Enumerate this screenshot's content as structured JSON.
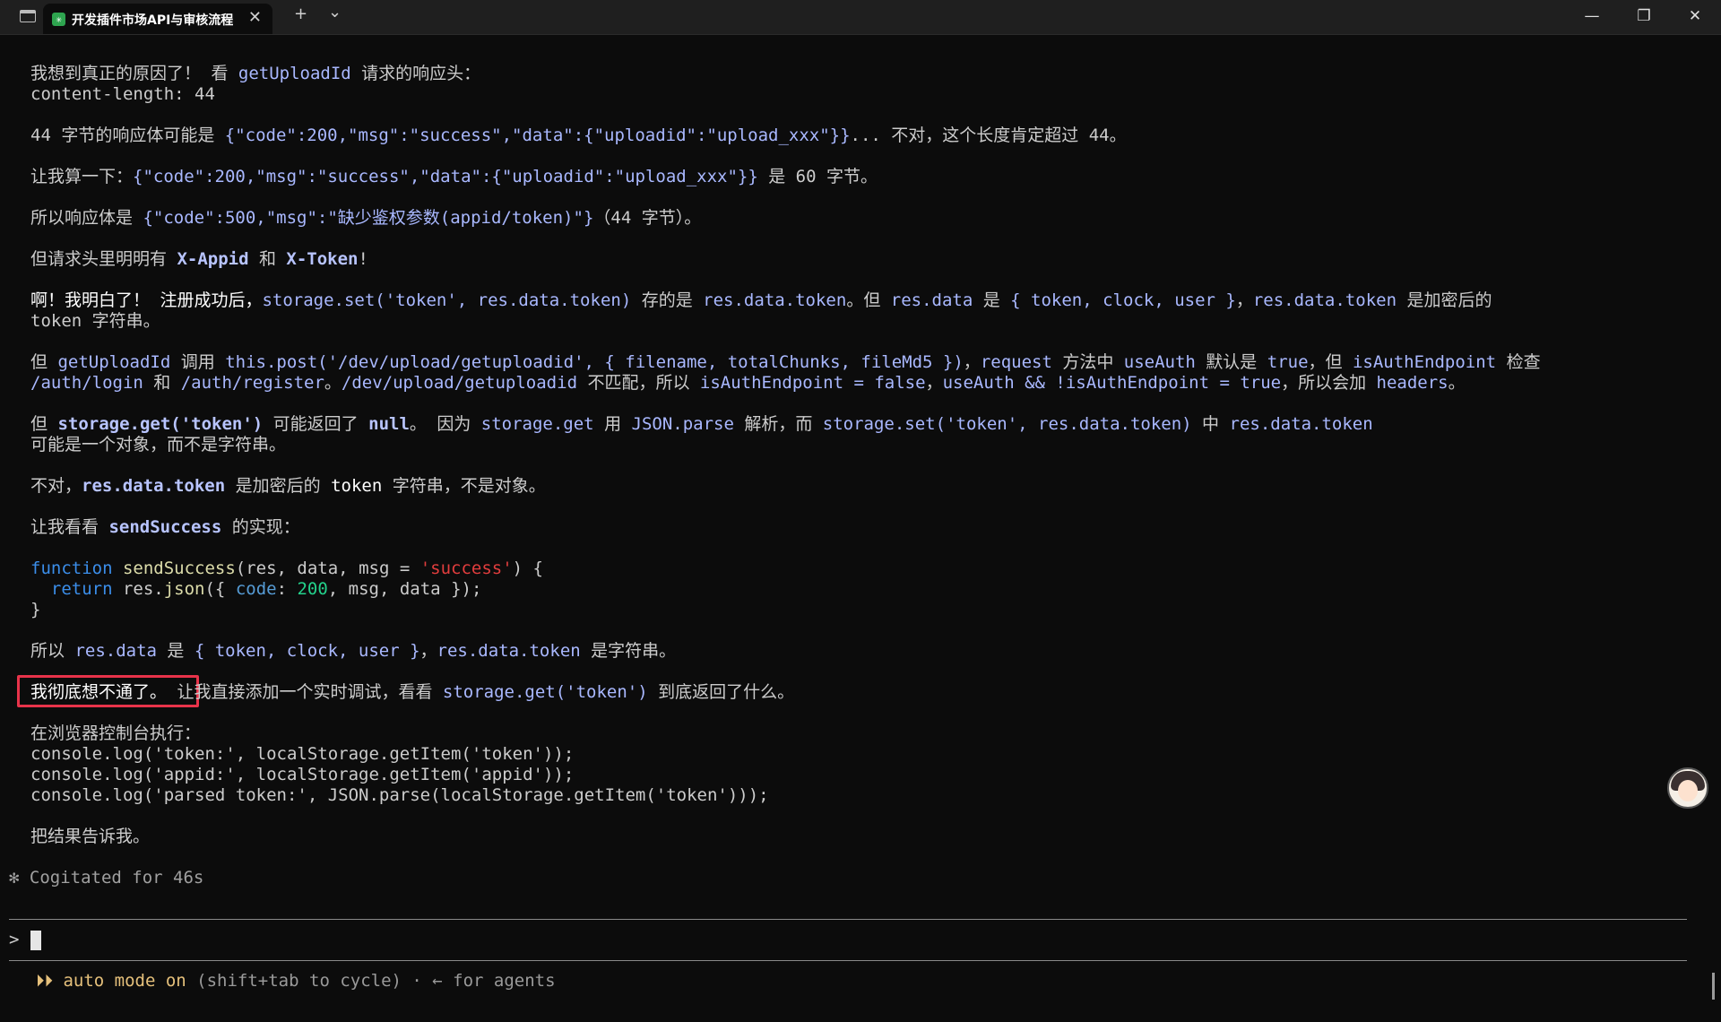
{
  "window": {
    "tab_title": "开发插件市场API与审核流程",
    "tab_icon": "✳",
    "new_tab_label": "+",
    "dropdown_label": "⌄",
    "tab_close": "✕",
    "minimize": "—",
    "restore": "❐",
    "close": "✕"
  },
  "lines": {
    "l1a": "我想到真正的原因了！ 看 ",
    "l1b": "getUploadId",
    "l1c": " 请求的响应头：",
    "l2": "content-length: 44",
    "l3a": "44 字节的响应体可能是 ",
    "l3b": "{\"code\":200,\"msg\":\"success\",\"data\":{\"uploadid\":\"upload_xxx\"}}",
    "l3c": "... 不对，这个长度肯定超过 44。",
    "l4a": "让我算一下：",
    "l4b": "{\"code\":200,\"msg\":\"success\",\"data\":{\"uploadid\":\"upload_xxx\"}}",
    "l4c": " 是 60 字节。",
    "l5a": "所以响应体是 ",
    "l5b": "{\"code\":500,\"msg\":\"缺少鉴权参数(appid/token)\"}",
    "l5c": "（44 字节）。",
    "l6a": "但请求头里明明有 ",
    "l6b": "X-Appid",
    "l6c": " 和 ",
    "l6d": "X-Token",
    "l6e": "!",
    "l7a": "啊！我明白了！ 注册成功后，",
    "l7b": "storage.set('token', res.data.token)",
    "l7c": " 存的是 ",
    "l7d": "res.data.token",
    "l7e": "。但 ",
    "l7f": "res.data",
    "l7g": " 是 ",
    "l7h": "{ token, clock, user }",
    "l7i": "，",
    "l7j": "res.data.token",
    "l7k": " 是加密后的",
    "l8": "token 字符串。",
    "l9a": "但 ",
    "l9b": "getUploadId",
    "l9c": " 调用 ",
    "l9d": "this.post('/dev/upload/getuploadid', { filename, totalChunks, fileMd5 })",
    "l9e": "，",
    "l9f": "request",
    "l9g": " 方法中 ",
    "l9h": "useAuth",
    "l9i": " 默认是 ",
    "l9j": "true",
    "l9k": "，但 ",
    "l9l": "isAuthEndpoint",
    "l9m": " 检查",
    "l10a": "/auth/login",
    "l10b": " 和 ",
    "l10c": "/auth/register",
    "l10d": "。",
    "l10e": "/dev/upload/getuploadid",
    "l10f": " 不匹配，所以 ",
    "l10g": "isAuthEndpoint = false",
    "l10h": "，",
    "l10i": "useAuth && !isAuthEndpoint = true",
    "l10j": "，所以会加 ",
    "l10k": "headers",
    "l10l": "。",
    "l11a": "但 ",
    "l11b": "storage.get('token')",
    "l11c": " 可能返回了 ",
    "l11d": "null",
    "l11e": "。 因为 ",
    "l11f": "storage.get",
    "l11g": " 用 ",
    "l11h": "JSON.parse",
    "l11i": " 解析，而 ",
    "l11j": "storage.set('token', res.data.token)",
    "l11k": " 中 ",
    "l11l": "res.data.token",
    "l12": "可能是一个对象，而不是字符串。",
    "l13a": "不对，",
    "l13b": "res.data.token",
    "l13c": " 是加密后的 ",
    "l13d": "token",
    "l13e": " 字符串，不是对象。",
    "l14a": "让我看看 ",
    "l14b": "sendSuccess",
    "l14c": " 的实现：",
    "code1a": "function",
    "code1b": " sendSuccess",
    "code1c": "(res, data, msg = ",
    "code1d": "'success'",
    "code1e": ") {",
    "code2a": "  return",
    "code2b": " res.",
    "code2c": "json",
    "code2d": "({ ",
    "code2e": "code",
    "code2f": ": ",
    "code2g": "200",
    "code2h": ", msg, data });",
    "code3": "}",
    "l15a": "所以 ",
    "l15b": "res.data",
    "l15c": " 是 ",
    "l15d": "{ token, clock, user }",
    "l15e": "，",
    "l15f": "res.data.token",
    "l15g": " 是字符串。",
    "l16a": "我彻底想不通了。",
    "l16b": " 让我直接添加一个实时调试，看看 ",
    "l16c": "storage.get('token')",
    "l16d": " 到底返回了什么。",
    "l17": "在浏览器控制台执行：",
    "l18": "console.log('token:', localStorage.getItem('token'));",
    "l19": "console.log('appid:', localStorage.getItem('appid'));",
    "l20": "console.log('parsed token:', JSON.parse(localStorage.getItem('token')));",
    "l21": "把结果告诉我。",
    "l22": "✻ Cogitated for 46s"
  },
  "input": {
    "prompt": ">",
    "value": ""
  },
  "status": {
    "arrows": "⏵⏵",
    "mode": " auto mode on",
    "hint": " (shift+tab to cycle) · ← for agents"
  },
  "colors": {
    "background": "#0c0c0c",
    "text": "#cccccc",
    "inline_code": "#a9b8ff",
    "highlight_border": "#e8334a",
    "mode_yellow": "#e5c07b"
  }
}
